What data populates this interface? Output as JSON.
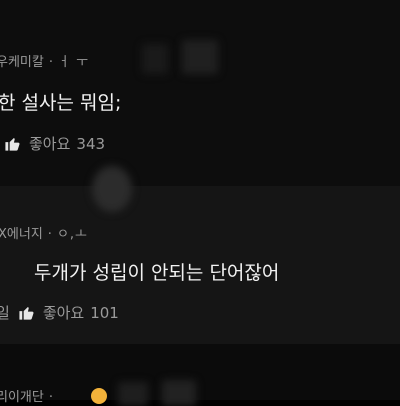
{
  "comments": [
    {
      "author": "우케미칼",
      "dot": "·",
      "meta_suffix": "ㅓ ㅜ",
      "text": "한 설사는 뭐임;",
      "like_label": "좋아요",
      "like_count": "343"
    },
    {
      "author": "X에너지",
      "dot": "·",
      "meta_suffix": "ㅇ,ㅗ",
      "text": "두개가 성립이 안되는 단어잖어",
      "lead": "일",
      "like_label": "좋아요",
      "like_count": "101"
    },
    {
      "author": "리이개단",
      "dot": "·"
    }
  ],
  "icons": {
    "like": "thumbs-up-icon",
    "emoji": "emoji-icon"
  },
  "colors": {
    "background": "#000000",
    "text": "#f2f2f2",
    "meta": "#9a9a9a",
    "emoji": "#f2b23a"
  }
}
